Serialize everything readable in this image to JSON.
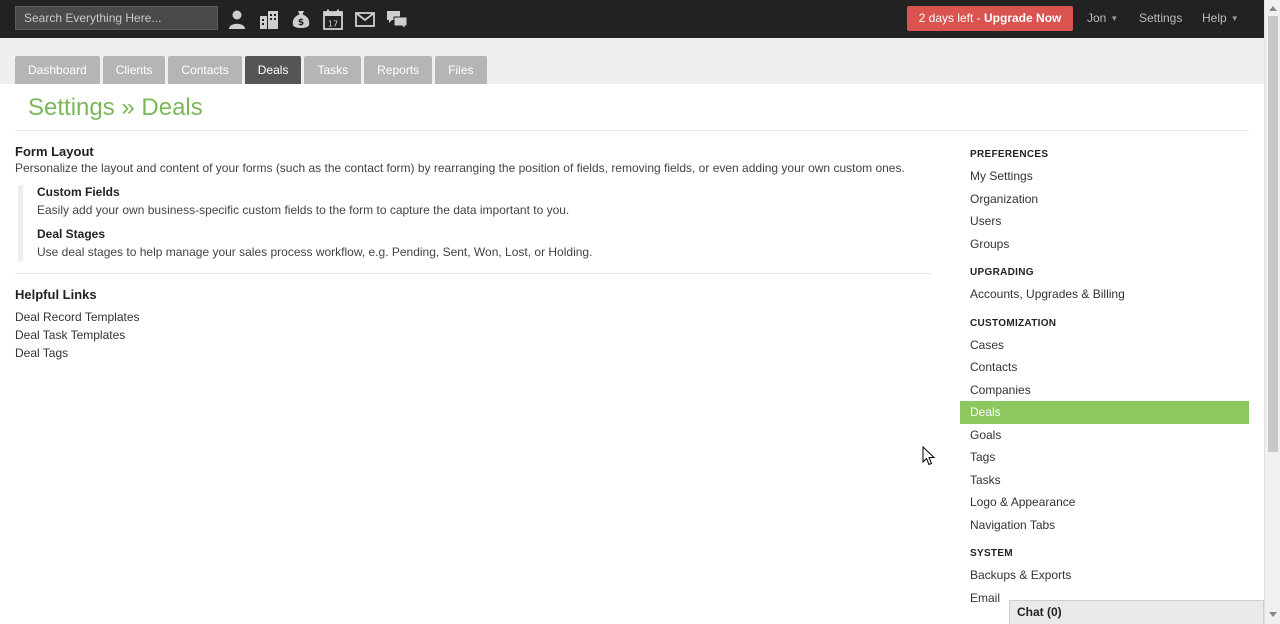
{
  "topbar": {
    "search_placeholder": "Search Everything Here...",
    "quick_icons": [
      "add-contact-icon",
      "companies-icon",
      "deals-icon",
      "calendar-icon",
      "email-icon",
      "chat-bubbles-icon"
    ],
    "calendar_day": "17",
    "upgrade": {
      "prefix": "2 days left - ",
      "action": "Upgrade Now"
    },
    "user_label": "Jon",
    "settings_label": "Settings",
    "help_label": "Help"
  },
  "tabs": [
    "Dashboard",
    "Clients",
    "Contacts",
    "Deals",
    "Tasks",
    "Reports",
    "Files"
  ],
  "active_tab": "Deals",
  "page_title": "Settings » Deals",
  "main": {
    "form_layout": {
      "heading": "Form Layout",
      "description": "Personalize the layout and content of your forms (such as the contact form) by rearranging the position of fields, removing fields, or even adding your own custom ones.",
      "items": [
        {
          "title": "Custom Fields",
          "desc": "Easily add your own business-specific custom fields to the form to capture the data important to you."
        },
        {
          "title": "Deal Stages",
          "desc": "Use deal stages to help manage your sales process workflow, e.g. Pending, Sent, Won, Lost, or Holding."
        }
      ]
    },
    "helpful_links": {
      "heading": "Helpful Links",
      "links": [
        "Deal Record Templates",
        "Deal Task Templates",
        "Deal Tags"
      ]
    }
  },
  "sidebar": {
    "preferences": {
      "heading": "PREFERENCES",
      "items": [
        "My Settings",
        "Organization",
        "Users",
        "Groups"
      ]
    },
    "upgrading": {
      "heading": "UPGRADING",
      "items": [
        "Accounts, Upgrades & Billing"
      ]
    },
    "customization": {
      "heading": "CUSTOMIZATION",
      "items": [
        "Cases",
        "Contacts",
        "Companies",
        "Deals",
        "Goals",
        "Tags",
        "Tasks",
        "Logo & Appearance",
        "Navigation Tabs"
      ]
    },
    "system": {
      "heading": "SYSTEM",
      "items": [
        "Backups & Exports",
        "Email"
      ]
    },
    "active_item": "Deals"
  },
  "chat": {
    "label": "Chat (0)"
  },
  "colors": {
    "accent_green": "#7cb85a",
    "active_sidebar": "#8dc760",
    "upgrade_red": "#d9534f",
    "topbar": "#222222"
  }
}
